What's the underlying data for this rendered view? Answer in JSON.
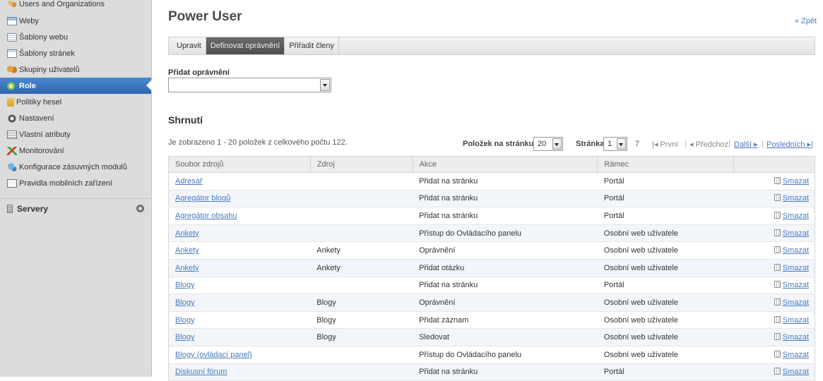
{
  "sidebar": {
    "items": [
      {
        "label": "Users and Organizations",
        "icon": "users-icon"
      },
      {
        "label": "Weby",
        "icon": "web-icon"
      },
      {
        "label": "Šablony webu",
        "icon": "site-template-icon"
      },
      {
        "label": "Šablony stránek",
        "icon": "page-template-icon"
      },
      {
        "label": "Skupiny uživatelů",
        "icon": "user-groups-icon"
      },
      {
        "label": "Role",
        "icon": "role-icon"
      },
      {
        "label": "Politiky hesel",
        "icon": "password-policy-icon"
      },
      {
        "label": "Nastavení",
        "icon": "settings-icon"
      },
      {
        "label": "Vlastní atributy",
        "icon": "custom-attributes-icon"
      },
      {
        "label": "Monitorování",
        "icon": "monitoring-icon"
      },
      {
        "label": "Konfigurace zásuvných modulů",
        "icon": "plugin-config-icon"
      },
      {
        "label": "Pravidla mobilních zařízení",
        "icon": "mobile-rules-icon"
      }
    ],
    "section": {
      "label": "Servery",
      "icon": "server-icon"
    }
  },
  "header": {
    "title": "Power User",
    "back": "« Zpět"
  },
  "tabs": [
    {
      "label": "Upravit"
    },
    {
      "label": "Definovat oprávnění"
    },
    {
      "label": "Přiřadit členy"
    }
  ],
  "add_permission": {
    "label": "Přidat oprávnění",
    "value": ""
  },
  "summary": {
    "title": "Shrnutí",
    "count": "Je zobrazeno 1 - 20 položek z celkového počtu 122.",
    "per_page_label": "Položek na stránku",
    "per_page": "20",
    "page_label": "Stránka",
    "page": "1",
    "total_pages": "7",
    "first": "První",
    "prev": "Předchozí",
    "next": "Další",
    "last": "Posledních"
  },
  "table": {
    "columns": [
      "Soubor zdrojů",
      "Zdroj",
      "Akce",
      "Rámec",
      ""
    ],
    "delete_label": "Smazat",
    "rows": [
      {
        "resource": "Adresář",
        "source": "",
        "action": "Přidat na stránku",
        "scope": "Portál"
      },
      {
        "resource": "Agregátor blogů",
        "source": "",
        "action": "Přidat na stránku",
        "scope": "Portál"
      },
      {
        "resource": "Agregátor obsahu",
        "source": "",
        "action": "Přidat na stránku",
        "scope": "Portál"
      },
      {
        "resource": "Ankety",
        "source": "",
        "action": "Přístup do Ovládacího panelu",
        "scope": "Osobní web uživatele"
      },
      {
        "resource": "Ankety",
        "source": "Ankety",
        "action": "Oprávnění",
        "scope": "Osobní web uživatele"
      },
      {
        "resource": "Ankety",
        "source": "Ankety",
        "action": "Přidat otázku",
        "scope": "Osobní web uživatele"
      },
      {
        "resource": "Blogy",
        "source": "",
        "action": "Přidat na stránku",
        "scope": "Portál"
      },
      {
        "resource": "Blogy",
        "source": "Blogy",
        "action": "Oprávnění",
        "scope": "Osobní web uživatele"
      },
      {
        "resource": "Blogy",
        "source": "Blogy",
        "action": "Přidat záznam",
        "scope": "Osobní web uživatele"
      },
      {
        "resource": "Blogy",
        "source": "Blogy",
        "action": "Sledovat",
        "scope": "Osobní web uživatele"
      },
      {
        "resource": "Blogy (ovládací panel)",
        "source": "",
        "action": "Přístup do Ovládacího panelu",
        "scope": "Osobní web uživatele"
      },
      {
        "resource": "Diskusní fórum",
        "source": "",
        "action": "Přidat na stránku",
        "scope": "Portál"
      }
    ]
  },
  "colors": {
    "accent": "#3a78bf",
    "link": "#4a7bbf",
    "sidebar_bg": "#dcdcdc"
  }
}
